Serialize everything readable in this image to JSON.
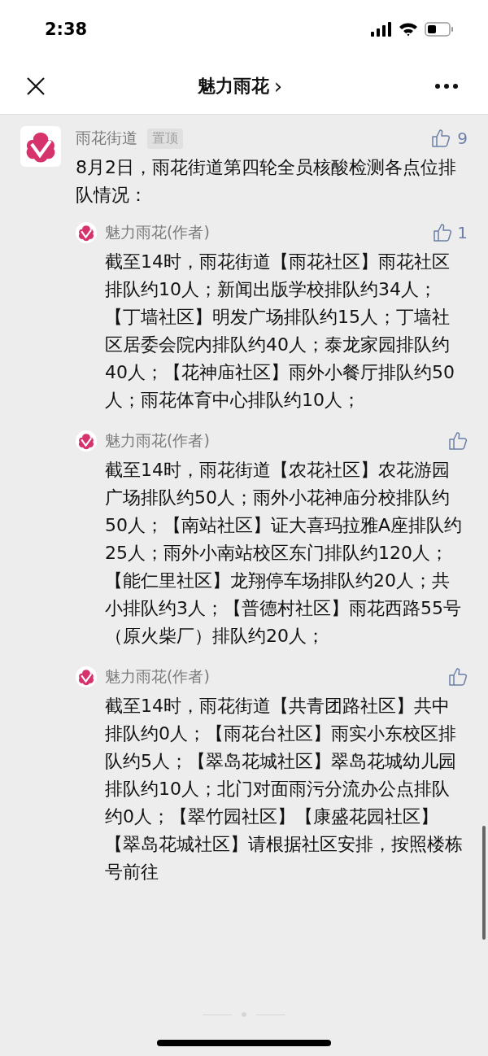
{
  "status_bar": {
    "time": "2:38"
  },
  "nav": {
    "title": "魅力雨花",
    "chevron": "›"
  },
  "post": {
    "author": "雨花街道",
    "badge": "置顶",
    "likes": "9",
    "text": "8月2日，雨花街道第四轮全员核酸检测各点位排队情况：",
    "replies": [
      {
        "author": "魅力雨花(作者)",
        "likes": "1",
        "text": "截至14时，雨花街道【雨花社区】雨花社区排队约10人；新闻出版学校排队约34人；【丁墙社区】明发广场排队约15人；丁墙社区居委会院内排队约40人；泰龙家园排队约40人；【花神庙社区】雨外小餐厅排队约50人；雨花体育中心排队约10人；"
      },
      {
        "author": "魅力雨花(作者)",
        "text": "截至14时，雨花街道【农花社区】农花游园广场排队约50人；雨外小花神庙分校排队约50人；【南站社区】证大喜玛拉雅A座排队约25人；雨外小南站校区东门排队约120人；【能仁里社区】龙翔停车场排队约20人；共小排队约3人；【普德村社区】雨花西路55号（原火柴厂）排队约20人；"
      },
      {
        "author": "魅力雨花(作者)",
        "text": "截至14时，雨花街道【共青团路社区】共中排队约0人；【雨花台社区】雨实小东校区排队约5人；【翠岛花城社区】翠岛花城幼儿园排队约10人；北门对面雨污分流办公点排队约0人；【翠竹园社区】【康盛花园社区】【翠岛花城社区】请根据社区安排，按照楼栋号前往"
      }
    ]
  }
}
